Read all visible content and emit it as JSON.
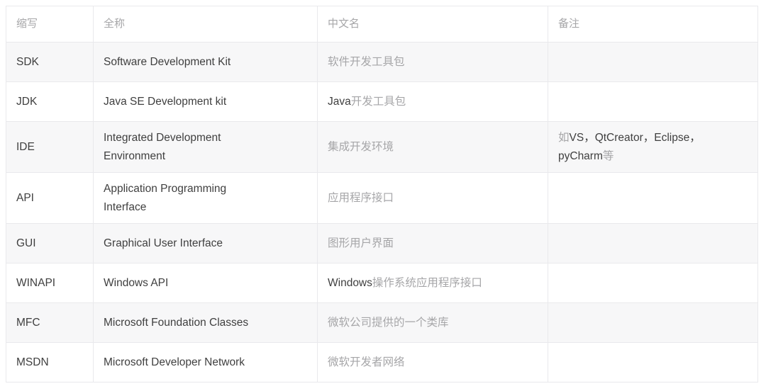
{
  "table": {
    "columns": [
      {
        "key": "abbr",
        "label": "缩写"
      },
      {
        "key": "full",
        "label": "全称"
      },
      {
        "key": "cn",
        "label": "中文名"
      },
      {
        "key": "note",
        "label": "备注"
      }
    ],
    "colors": {
      "border": "#e9e9ec",
      "stripe": "#f7f7f8",
      "row_background": "#ffffff",
      "latin_text": "#3f3f3f",
      "cjk_text": "#a6a6a8",
      "header_text": "#a6a6a8"
    },
    "rows": [
      {
        "abbr": "SDK",
        "full": "Software Development Kit",
        "full_line1": "Software Development Kit",
        "full_line2": "",
        "cn_latin": "",
        "cn_cjk": "软件开发工具包",
        "note_line1_cjk_a": "",
        "note_line1_latin": "",
        "note_line1_cjk_b": "",
        "note_line2_latin": "",
        "note_line2_cjk": ""
      },
      {
        "abbr": "JDK",
        "full": "Java SE Development kit",
        "full_line1": "Java SE Development kit",
        "full_line2": "",
        "cn_latin": "Java",
        "cn_cjk": "开发工具包",
        "note_line1_cjk_a": "",
        "note_line1_latin": "",
        "note_line1_cjk_b": "",
        "note_line2_latin": "",
        "note_line2_cjk": ""
      },
      {
        "abbr": "IDE",
        "full": "Integrated Development Environment",
        "full_line1": "Integrated Development",
        "full_line2": "Environment",
        "cn_latin": "",
        "cn_cjk": "集成开发环境",
        "note_line1_cjk_a": "如",
        "note_line1_latin": "VS，QtCreator，Eclipse，",
        "note_line1_cjk_b": "",
        "note_line2_latin": "pyCharm",
        "note_line2_cjk": "等"
      },
      {
        "abbr": "API",
        "full": "Application Programming Interface",
        "full_line1": "Application Programming",
        "full_line2": "Interface",
        "cn_latin": "",
        "cn_cjk": "应用程序接口",
        "note_line1_cjk_a": "",
        "note_line1_latin": "",
        "note_line1_cjk_b": "",
        "note_line2_latin": "",
        "note_line2_cjk": ""
      },
      {
        "abbr": "GUI",
        "full": "Graphical User Interface",
        "full_line1": "Graphical User Interface",
        "full_line2": "",
        "cn_latin": "",
        "cn_cjk": "图形用户界面",
        "note_line1_cjk_a": "",
        "note_line1_latin": "",
        "note_line1_cjk_b": "",
        "note_line2_latin": "",
        "note_line2_cjk": ""
      },
      {
        "abbr": "WINAPI",
        "full": "Windows API",
        "full_line1": "Windows API",
        "full_line2": "",
        "cn_latin": "Windows",
        "cn_cjk": "操作系统应用程序接口",
        "note_line1_cjk_a": "",
        "note_line1_latin": "",
        "note_line1_cjk_b": "",
        "note_line2_latin": "",
        "note_line2_cjk": ""
      },
      {
        "abbr": "MFC",
        "full": "Microsoft Foundation Classes",
        "full_line1": "Microsoft Foundation Classes",
        "full_line2": "",
        "cn_latin": "",
        "cn_cjk": "微软公司提供的一个类库",
        "note_line1_cjk_a": "",
        "note_line1_latin": "",
        "note_line1_cjk_b": "",
        "note_line2_latin": "",
        "note_line2_cjk": ""
      },
      {
        "abbr": "MSDN",
        "full": "Microsoft Developer Network",
        "full_line1": "Microsoft Developer Network",
        "full_line2": "",
        "cn_latin": "",
        "cn_cjk": "微软开发者网络",
        "note_line1_cjk_a": "",
        "note_line1_latin": "",
        "note_line1_cjk_b": "",
        "note_line2_latin": "",
        "note_line2_cjk": ""
      }
    ]
  }
}
